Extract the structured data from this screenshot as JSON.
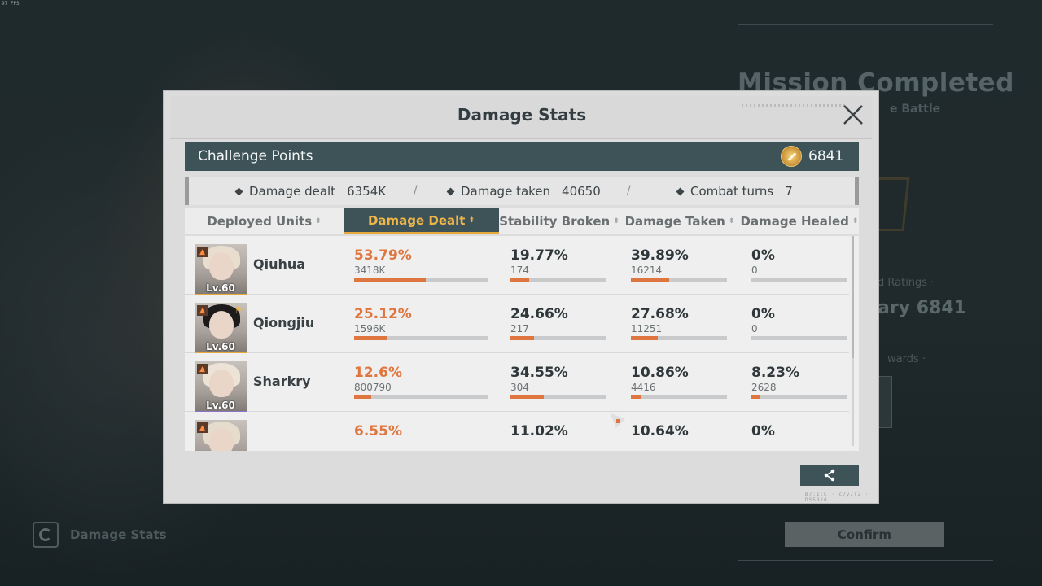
{
  "fps_text": "97 FPS",
  "background": {
    "mission_title": "Mission Completed",
    "mission_sub": "e Battle",
    "rating_label": "d Ratings ·",
    "rating_value": "ary 6841",
    "rewards_label": "wards ·",
    "confirm_label": "Confirm",
    "bottom_left_label": "Damage Stats"
  },
  "modal": {
    "title": "Damage Stats",
    "challenge": {
      "label": "Challenge Points",
      "value": "6841"
    },
    "summary": [
      {
        "label": "Damage dealt",
        "value": "6354K"
      },
      {
        "label": "Damage taken",
        "value": "40650"
      },
      {
        "label": "Combat turns",
        "value": "7"
      }
    ],
    "separator": "/",
    "columns": [
      "Deployed Units",
      "Damage Dealt",
      "Stability Broken",
      "Damage Taken",
      "Damage Healed"
    ],
    "active_column": "Damage Dealt",
    "sort_glyph": "⬍",
    "units": [
      {
        "name": "Qiuhua",
        "level": "Lv.60",
        "hair": "#e9ddcf",
        "rarity": "#e8a93c",
        "role": "",
        "dealt": {
          "pct": "53.79%",
          "num": "3418K",
          "frac": 0.5379
        },
        "broken": {
          "pct": "19.77%",
          "num": "174",
          "frac": 0.1977
        },
        "taken": {
          "pct": "39.89%",
          "num": "16214",
          "frac": 0.3989
        },
        "healed": {
          "pct": "0%",
          "num": "0",
          "frac": 0
        }
      },
      {
        "name": "Qiongjiu",
        "level": "Lv.60",
        "hair": "#1d1a1c",
        "rarity": "#e8a93c",
        "role": "⚑",
        "dealt": {
          "pct": "25.12%",
          "num": "1596K",
          "frac": 0.2512
        },
        "broken": {
          "pct": "24.66%",
          "num": "217",
          "frac": 0.2466
        },
        "taken": {
          "pct": "27.68%",
          "num": "11251",
          "frac": 0.2768
        },
        "healed": {
          "pct": "0%",
          "num": "0",
          "frac": 0
        }
      },
      {
        "name": "Sharkry",
        "level": "Lv.60",
        "hair": "#ece3d6",
        "rarity": "#8a72c9",
        "role": "",
        "dealt": {
          "pct": "12.6%",
          "num": "800790",
          "frac": 0.126
        },
        "broken": {
          "pct": "34.55%",
          "num": "304",
          "frac": 0.3455
        },
        "taken": {
          "pct": "10.86%",
          "num": "4416",
          "frac": 0.1086
        },
        "healed": {
          "pct": "8.23%",
          "num": "2628",
          "frac": 0.0823
        }
      },
      {
        "name": "",
        "level": "",
        "hair": "#e6dccd",
        "rarity": "#e8a93c",
        "role": "",
        "dealt": {
          "pct": "6.55%",
          "num": "",
          "frac": 0.0655
        },
        "broken": {
          "pct": "11.02%",
          "num": "",
          "frac": 0.1102
        },
        "taken": {
          "pct": "10.64%",
          "num": "",
          "frac": 0.1064
        },
        "healed": {
          "pct": "0%",
          "num": "",
          "frac": 0
        }
      }
    ],
    "footer_id": "B7:1:C · c7y/T2 · DS5B/d"
  },
  "colors": {
    "accent": "#e0763f",
    "header_teal": "#3d5358",
    "gold": "#f0b64a"
  },
  "icons": {
    "close": "close-icon",
    "share": "share-icon",
    "challenge": "challenge-medal-icon",
    "element": "fire-icon"
  }
}
